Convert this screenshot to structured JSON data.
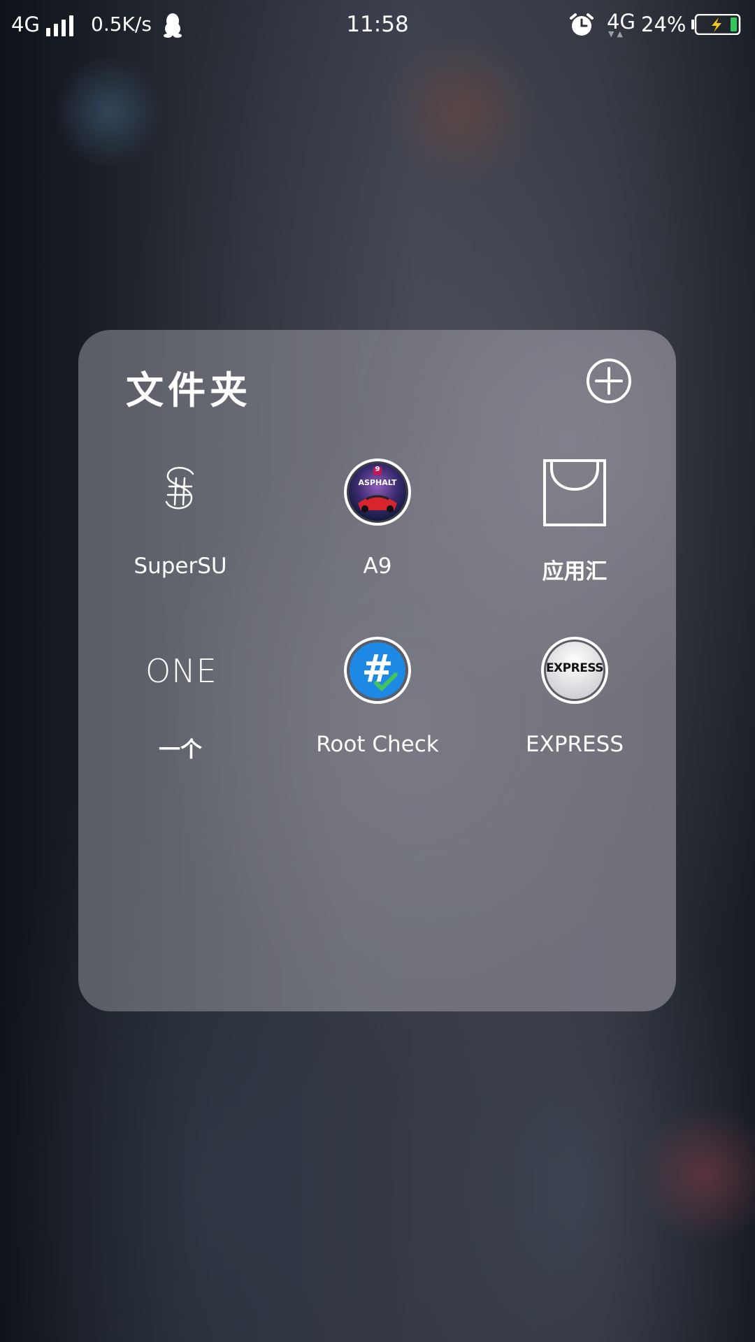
{
  "status_bar": {
    "network": "4G",
    "speed": "0.5K/s",
    "time": "11:58",
    "network2": "4G",
    "battery_percent": "24%",
    "icons": [
      "signal-icon",
      "qq-icon",
      "alarm-icon",
      "battery-charging-icon"
    ]
  },
  "folder": {
    "title": "文件夹",
    "add_icon": "add-circle-icon",
    "apps": [
      {
        "label": "SuperSU",
        "icon": "supersu-icon"
      },
      {
        "label": "A9",
        "icon": "asphalt-icon",
        "icon_text": "ASPHALT",
        "icon_badge": "9"
      },
      {
        "label": "应用汇",
        "icon": "appchina-bag-icon"
      },
      {
        "label": "一个",
        "icon": "one-icon",
        "icon_text": "ONE"
      },
      {
        "label": "Root Check",
        "icon": "root-check-icon",
        "icon_text": "#"
      },
      {
        "label": "EXPRESS",
        "icon": "express-icon",
        "icon_text": "EXPRESS"
      }
    ]
  },
  "colors": {
    "root_check_blue": "#1e88e5",
    "battery_green": "#35c759",
    "charge_bolt": "#f5c518"
  }
}
